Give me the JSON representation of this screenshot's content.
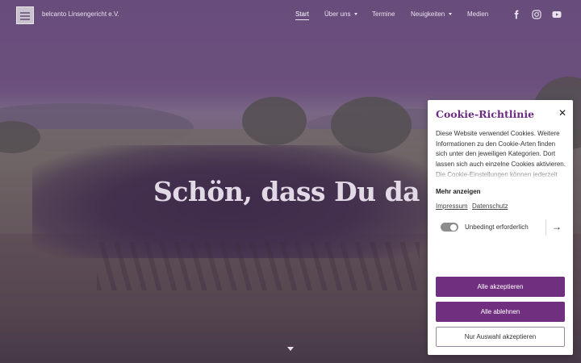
{
  "header": {
    "brand": "belcanto Linsengericht e.V.",
    "logo_icon": "choir-logo-icon",
    "nav": [
      {
        "label": "Start",
        "active": true,
        "dropdown": false
      },
      {
        "label": "Über uns",
        "active": false,
        "dropdown": true
      },
      {
        "label": "Termine",
        "active": false,
        "dropdown": false
      },
      {
        "label": "Neuigkeiten",
        "active": false,
        "dropdown": true
      },
      {
        "label": "Medien",
        "active": false,
        "dropdown": false
      }
    ],
    "social_icons": [
      "facebook-icon",
      "instagram-icon",
      "youtube-icon"
    ]
  },
  "hero": {
    "title": "Schön, dass Du da bist!",
    "scroll_icon": "chevron-down-icon"
  },
  "cookie": {
    "title": "Cookie-Richtlinie",
    "close_icon": "close-icon",
    "text": "Diese Website verwendet Cookies. Weitere Informationen zu den Cookie-Arten finden sich unter den jeweiligen Kategorien. Dort lassen sich auch einzelne Cookies aktivieren. Die Cookie-Einstellungen können jederzeit über den",
    "more_label": "Mehr anzeigen",
    "links": [
      "Impressum",
      "Datenschutz"
    ],
    "category": {
      "label": "Unbedingt erforderlich",
      "enabled": true,
      "arrow_icon": "arrow-right-icon"
    },
    "buttons": {
      "accept_all": "Alle akzeptieren",
      "reject_all": "Alle ablehnen",
      "accept_selection": "Nur Auswahl akzeptieren"
    }
  },
  "colors": {
    "accent": "#71307f",
    "title": "#6d2c83",
    "overlay": "#5f3c73"
  }
}
